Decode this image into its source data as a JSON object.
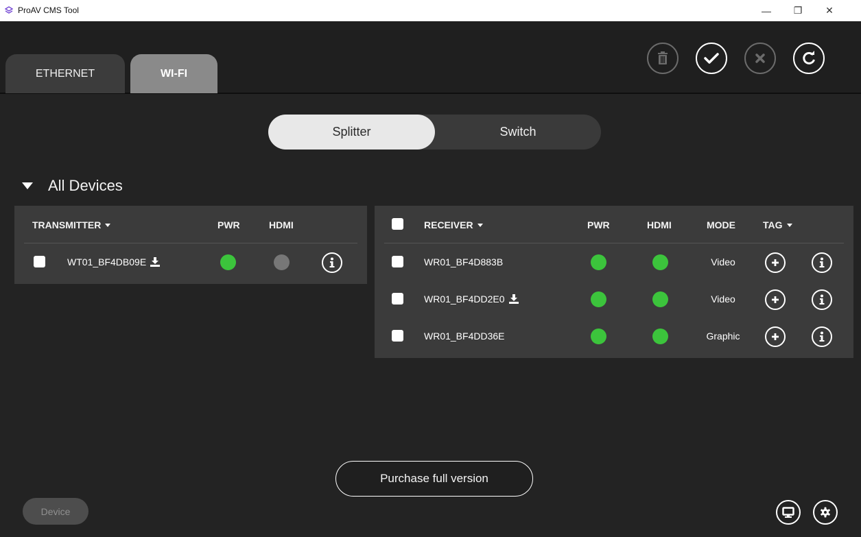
{
  "window": {
    "title": "ProAV CMS Tool",
    "minimize_glyph": "—",
    "restore_glyph": "❐",
    "close_glyph": "✕"
  },
  "tabs": [
    {
      "label": "ETHERNET",
      "active": false
    },
    {
      "label": "WI-FI",
      "active": true
    }
  ],
  "header_actions": [
    "trash-icon",
    "check-icon",
    "x-icon",
    "refresh-icon"
  ],
  "mode_toggle": {
    "options": [
      "Splitter",
      "Switch"
    ],
    "selected": "Splitter"
  },
  "section": {
    "title": "All Devices",
    "expanded": true
  },
  "transmitter_table": {
    "columns": {
      "name": "TRANSMITTER",
      "pwr": "PWR",
      "hdmi": "HDMI"
    },
    "rows": [
      {
        "name": "WT01_BF4DB09E",
        "download_icon": true,
        "pwr": "on",
        "hdmi": "off",
        "checked": false
      }
    ]
  },
  "receiver_table": {
    "columns": {
      "name": "RECEIVER",
      "pwr": "PWR",
      "hdmi": "HDMI",
      "mode": "MODE",
      "tag": "TAG"
    },
    "rows": [
      {
        "name": "WR01_BF4D883B",
        "download_icon": false,
        "pwr": "on",
        "hdmi": "on",
        "mode": "Video",
        "checked": false
      },
      {
        "name": "WR01_BF4DD2E0",
        "download_icon": true,
        "pwr": "on",
        "hdmi": "on",
        "mode": "Video",
        "checked": false
      },
      {
        "name": "WR01_BF4DD36E",
        "download_icon": false,
        "pwr": "on",
        "hdmi": "on",
        "mode": "Graphic",
        "checked": false
      }
    ]
  },
  "footer": {
    "purchase_label": "Purchase full version",
    "device_label": "Device"
  },
  "colors": {
    "background": "#232323",
    "panel": "#3b3b3b",
    "status_on": "#3cc43c",
    "status_off": "#777777",
    "active_tab": "#8a8a8a"
  }
}
